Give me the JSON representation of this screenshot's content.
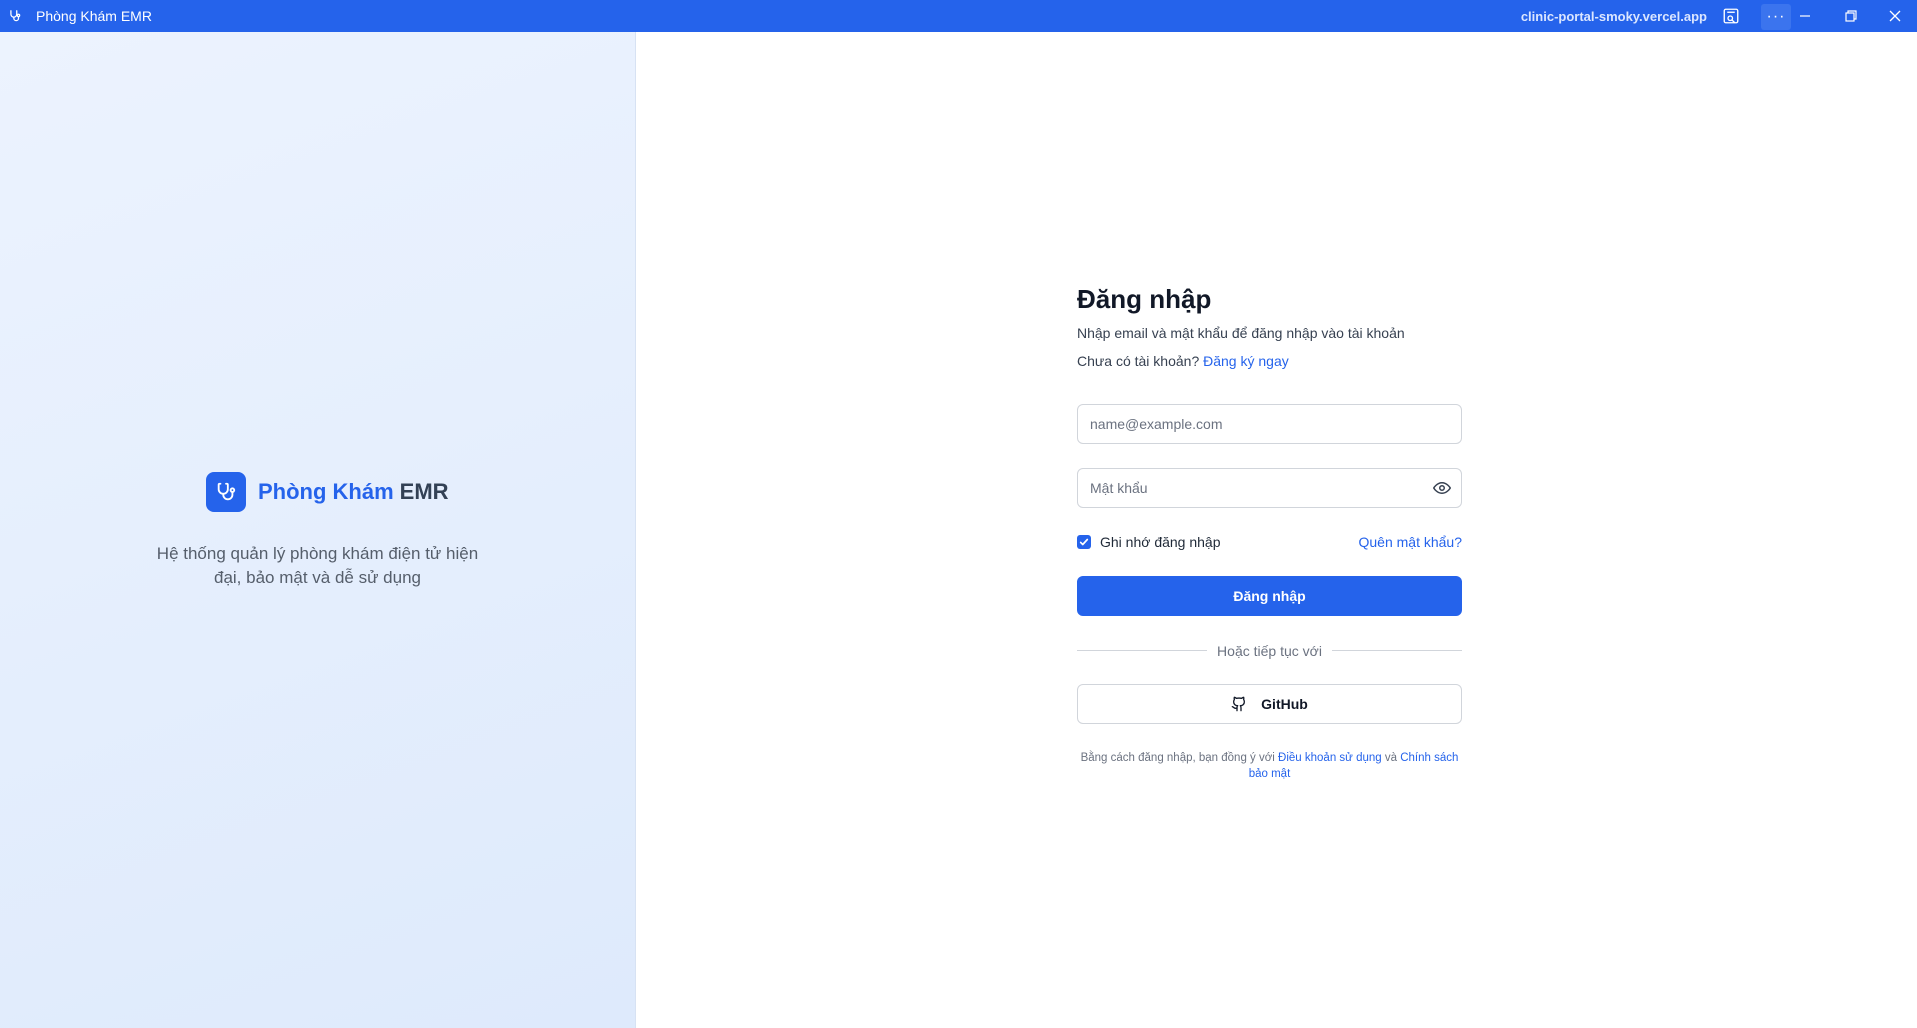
{
  "window": {
    "title": "Phòng Khám EMR",
    "url": "clinic-portal-smoky.vercel.app",
    "more_label": "···"
  },
  "brand": {
    "name": "Phòng Khám",
    "suffix": "EMR",
    "tagline": "Hệ thống quản lý phòng khám điện tử hiện đại, bảo mật và dễ sử dụng",
    "icon": "stethoscope-icon"
  },
  "login": {
    "heading": "Đăng nhập",
    "subtitle": "Nhập email và mật khẩu để đăng nhập vào tài khoản",
    "no_account_text": "Chưa có tài khoản?",
    "signup_link": "Đăng ký ngay",
    "email_placeholder": "name@example.com",
    "email_value": "",
    "password_placeholder": "Mật khẩu",
    "password_value": "",
    "remember_label": "Ghi nhớ đăng nhập",
    "remember_checked": true,
    "forgot_link": "Quên mật khẩu?",
    "submit_label": "Đăng nhập",
    "divider_text": "Hoặc tiếp tục với",
    "github_label": "GitHub",
    "terms_prefix": "Bằng cách đăng nhập, bạn đồng ý với",
    "terms_link": "Điều khoản sử dụng",
    "terms_and": "và",
    "privacy_link": "Chính sách bảo mật"
  },
  "colors": {
    "accent": "#2563eb",
    "title_bar": "#2563eb"
  }
}
